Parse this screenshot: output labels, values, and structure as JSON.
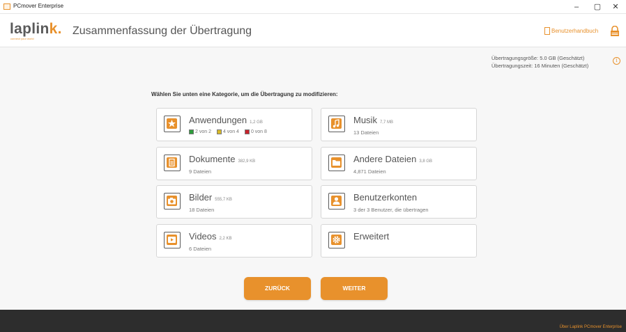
{
  "window": {
    "title": "PCmover Enterprise",
    "controls": {
      "minimize": "–",
      "maximize": "▢",
      "close": "✕"
    }
  },
  "header": {
    "logo_main": "laplin",
    "logo_accent": "k.",
    "tagline": "connect your world",
    "page_title": "Zusammenfassung der Übertragung",
    "manual_label": "Benutzerhandbuch"
  },
  "transfer_info": {
    "size": "Übertragungsgröße: 5.0 GB (Geschätzt)",
    "time": "Übertragungszeit: 16 Minuten (Geschätzt)",
    "info_glyph": "i"
  },
  "instruction": "Wählen Sie unten eine Kategorie, um die Übertragung zu modifizieren:",
  "categories": [
    {
      "key": "apps",
      "title": "Anwendungen",
      "size": "1,2 GB",
      "breakdown": [
        {
          "label": "2 von 2",
          "color": "#2e9d3c"
        },
        {
          "label": "4 von 4",
          "color": "#d8b928"
        },
        {
          "label": "0 von 8",
          "color": "#c8232c"
        }
      ],
      "icon": "star-icon"
    },
    {
      "key": "music",
      "title": "Musik",
      "size": "7,7 MB",
      "sub": "13 Dateien",
      "icon": "music-note-icon"
    },
    {
      "key": "documents",
      "title": "Dokumente",
      "size": "382,9 KB",
      "sub": "9 Dateien",
      "icon": "document-icon"
    },
    {
      "key": "other",
      "title": "Andere Dateien",
      "size": "3,8 GB",
      "sub": "4,871 Dateien",
      "icon": "folder-icon"
    },
    {
      "key": "pictures",
      "title": "Bilder",
      "size": "555,7 KB",
      "sub": "18 Dateien",
      "icon": "camera-icon"
    },
    {
      "key": "accounts",
      "title": "Benutzerkonten",
      "size": "",
      "sub": "3 der 3 Benutzer, die übertragen",
      "icon": "user-icon"
    },
    {
      "key": "videos",
      "title": "Videos",
      "size": "2,2 KB",
      "sub": "6 Dateien",
      "icon": "video-play-icon"
    },
    {
      "key": "advanced",
      "title": "Erweitert",
      "size": "",
      "sub": "",
      "icon": "gear-icon"
    }
  ],
  "buttons": {
    "back": "ZURÜCK",
    "next": "WEITER"
  },
  "footer": {
    "about": "Über Laplink PCmover Enterprise"
  },
  "colors": {
    "accent": "#e8912c",
    "footer_bg": "#2d2d2d"
  }
}
